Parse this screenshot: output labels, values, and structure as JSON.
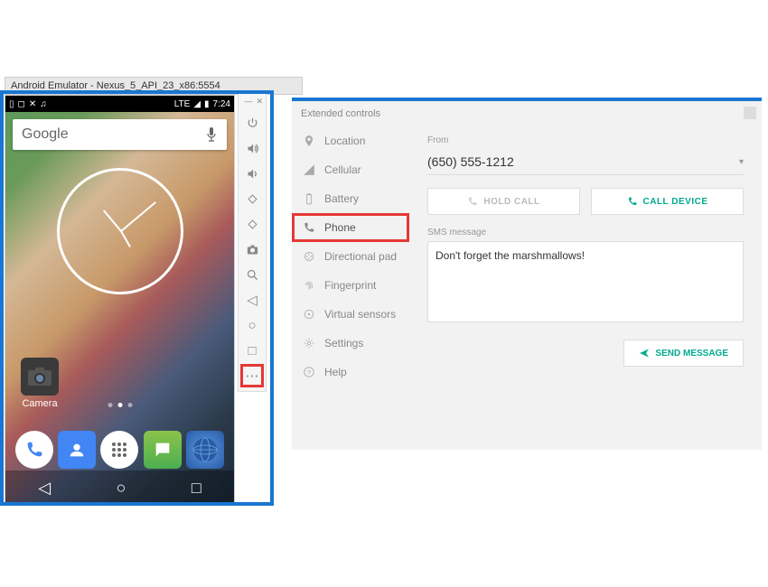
{
  "emulator": {
    "title": "Android Emulator - Nexus_5_API_23_x86:5554",
    "status": {
      "net": "LTE",
      "time": "7:24"
    },
    "search_text": "Google",
    "camera_label": "Camera"
  },
  "toolbar_icons": [
    "power",
    "vol-up",
    "vol-down",
    "rotate-left",
    "rotate-right",
    "camera",
    "zoom",
    "back",
    "home",
    "overview",
    "more"
  ],
  "ext": {
    "title": "Extended controls",
    "items": [
      {
        "k": "location",
        "label": "Location"
      },
      {
        "k": "cellular",
        "label": "Cellular"
      },
      {
        "k": "battery",
        "label": "Battery"
      },
      {
        "k": "phone",
        "label": "Phone"
      },
      {
        "k": "dpad",
        "label": "Directional pad"
      },
      {
        "k": "fingerprint",
        "label": "Fingerprint"
      },
      {
        "k": "sensors",
        "label": "Virtual sensors"
      },
      {
        "k": "settings",
        "label": "Settings"
      },
      {
        "k": "help",
        "label": "Help"
      }
    ],
    "phone": {
      "from_label": "From",
      "from_value": "(650) 555-1212",
      "hold_label": "HOLD CALL",
      "call_label": "CALL DEVICE",
      "sms_label": "SMS message",
      "sms_value": "Don't forget the marshmallows!",
      "send_label": "SEND MESSAGE"
    }
  }
}
